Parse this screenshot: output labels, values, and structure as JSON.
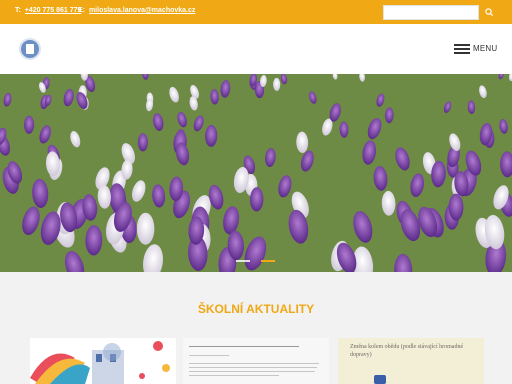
{
  "topbar": {
    "phone_label": "T:",
    "phone": "+420 775 861 779",
    "email_label": "E:",
    "email": "miloslava.lanova@machovka.cz",
    "search_placeholder": ""
  },
  "header": {
    "menu_label": "MENU"
  },
  "news": {
    "title": "ŠKOLNÍ AKTUALITY",
    "card3_text": "Změna kolem obědu (podle stávající hromadné dopravy)"
  },
  "colors": {
    "accent": "#f0a814",
    "text_dark": "#333333"
  },
  "icons": [
    "search-icon",
    "hamburger-menu-icon",
    "school-logo"
  ]
}
